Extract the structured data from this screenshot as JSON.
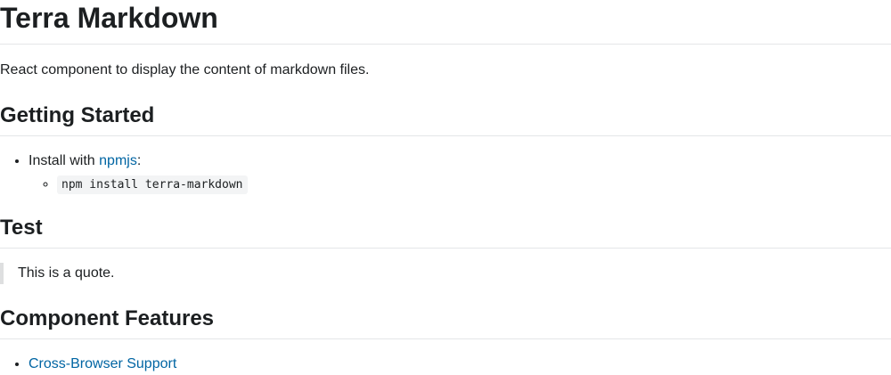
{
  "title": "Terra Markdown",
  "intro": "React component to display the content of markdown files.",
  "sections": {
    "getting_started": {
      "heading": "Getting Started",
      "install_prefix": "Install with ",
      "install_link": "npmjs",
      "install_suffix": ":",
      "command": "npm install terra-markdown"
    },
    "test": {
      "heading": "Test",
      "quote": "This is a quote."
    },
    "features": {
      "heading": "Component Features",
      "items": [
        "Cross-Browser Support"
      ]
    }
  },
  "colors": {
    "link": "#0065a3",
    "text": "#1c1f21",
    "rule": "#e4e6e8",
    "code_bg": "#f3f4f5",
    "quote_border": "#dedfe0"
  }
}
